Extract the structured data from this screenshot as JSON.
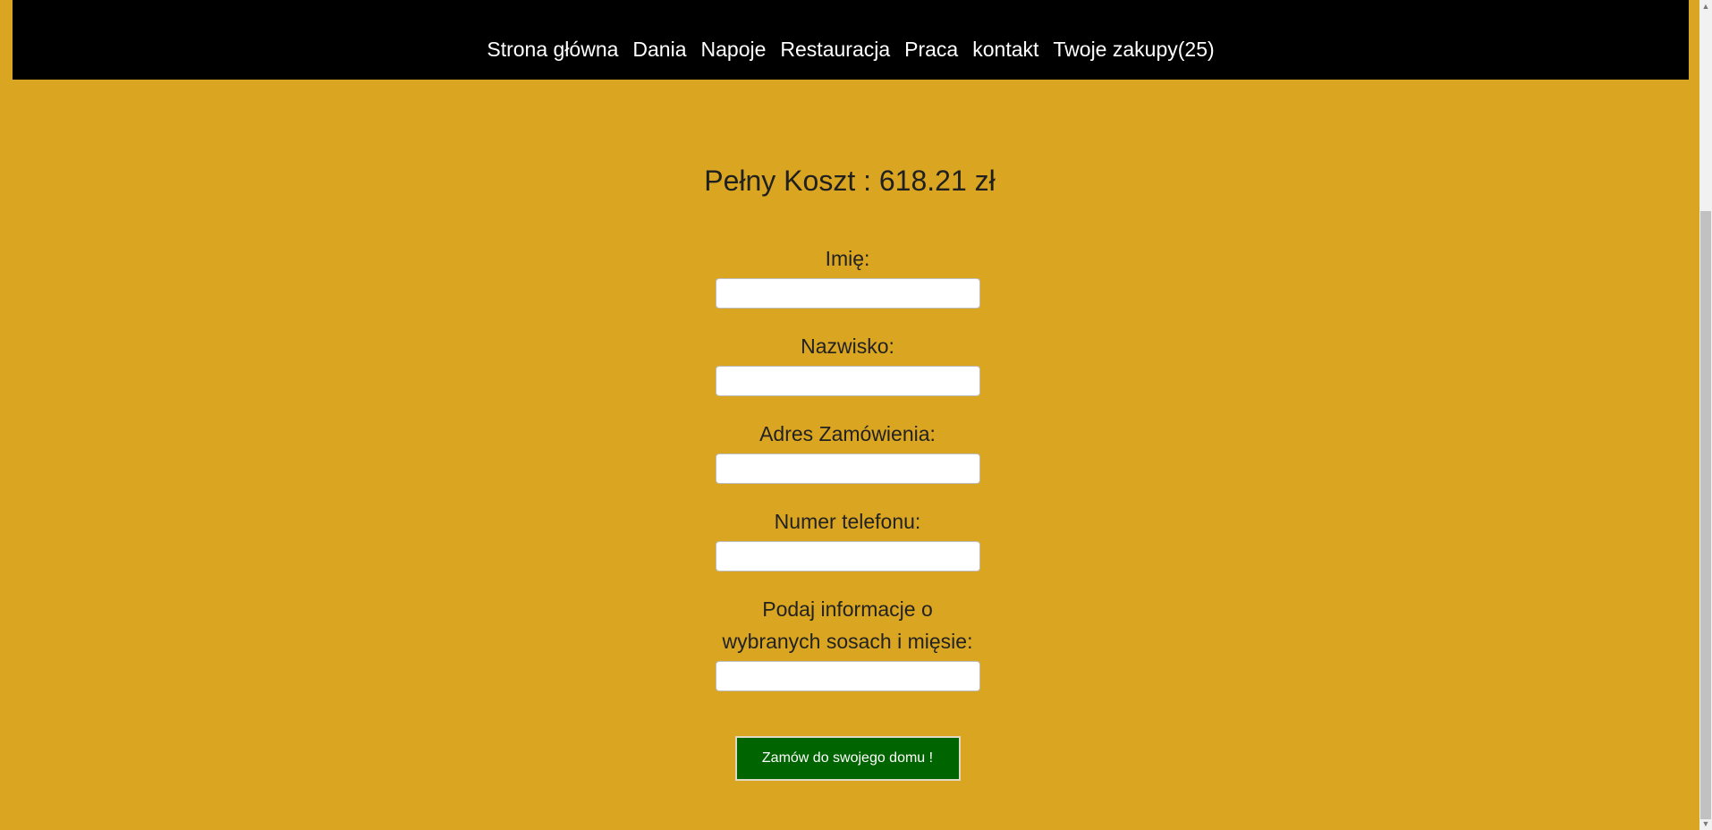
{
  "nav": {
    "items": [
      {
        "label": "Strona główna"
      },
      {
        "label": "Dania"
      },
      {
        "label": "Napoje"
      },
      {
        "label": "Restauracja"
      },
      {
        "label": "Praca"
      },
      {
        "label": "kontakt"
      },
      {
        "label": "Twoje zakupy(25)"
      }
    ]
  },
  "summary": {
    "total_text": "Pełny Koszt : 618.21 zł"
  },
  "form": {
    "first_name_label": "Imię:",
    "first_name_value": "",
    "last_name_label": "Nazwisko:",
    "last_name_value": "",
    "address_label": "Adres Zamówienia:",
    "address_value": "",
    "phone_label": "Numer telefonu:",
    "phone_value": "",
    "notes_label": "Podaj informacje o wybranych sosach i mięsie:",
    "notes_value": "",
    "submit_label": "Zamów do swojego domu !"
  },
  "scrollbar": {
    "up_icon": "triangle-up-icon",
    "down_icon": "triangle-down-icon"
  },
  "colors": {
    "background": "#daa520",
    "topbar": "#000000",
    "button": "#006400"
  }
}
